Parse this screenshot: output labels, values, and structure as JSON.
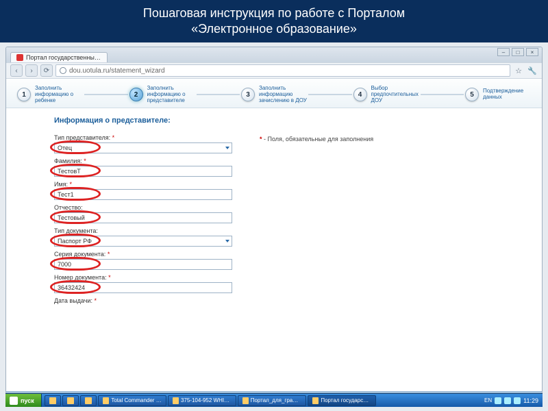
{
  "banner": {
    "line1": "Пошаговая инструкция по работе с Порталом",
    "line2": "«Электронное образование»"
  },
  "browser": {
    "tab_title": "Портал государственных ус",
    "url": "dou.uotula.ru/statement_wizard"
  },
  "stepper": {
    "s1": "Заполнить информацию о ребенке",
    "s2": "Заполнить информацию о представителе",
    "s3": "Заполнить информацию зачислению в ДОУ",
    "s4": "Выбор предпочтительных ДОУ",
    "s5": "Подтверждение данных"
  },
  "form": {
    "section_title": "Информация о представителе:",
    "required_note": "- Поля, обязательные для заполнения",
    "fields": {
      "rep_type": {
        "label": "Тип представителя:",
        "value": "Отец"
      },
      "lastname": {
        "label": "Фамилия:",
        "value": "ТестовТ"
      },
      "firstname": {
        "label": "Имя:",
        "value": "Тест1"
      },
      "middlename": {
        "label": "Отчество:",
        "value": "Тестовый"
      },
      "doc_type": {
        "label": "Тип документа:",
        "value": "Паспорт РФ"
      },
      "doc_series": {
        "label": "Серия документа:",
        "value": "7000"
      },
      "doc_number": {
        "label": "Номер документа:",
        "value": "36432424"
      },
      "issue_date": {
        "label": "Дата выдачи:",
        "value": ""
      }
    }
  },
  "taskbar": {
    "start": "пуск",
    "items": {
      "t1": "Total Commander 6...",
      "t2": "375-104-952 WHITE...",
      "t3": "Портал_для_гражда...",
      "t4": "Портал государств..."
    },
    "lang": "EN",
    "time": "11:29"
  }
}
